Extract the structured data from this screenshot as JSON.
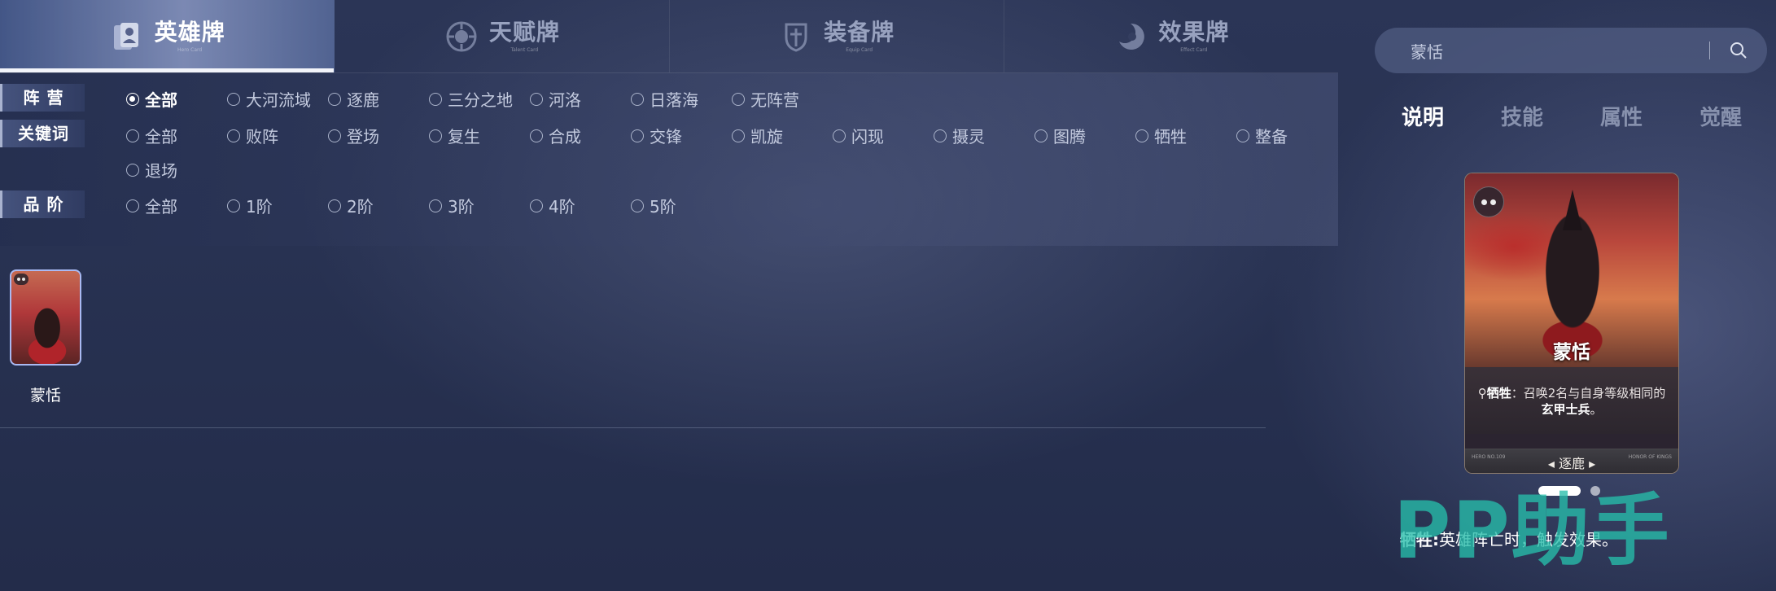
{
  "tabs": [
    {
      "label": "英雄牌",
      "sub": "Hero Card",
      "icon": "hero-card-icon",
      "active": true
    },
    {
      "label": "天赋牌",
      "sub": "Talent Card",
      "icon": "talent-card-icon",
      "active": false
    },
    {
      "label": "装备牌",
      "sub": "Equip Card",
      "icon": "equipment-card-icon",
      "active": false
    },
    {
      "label": "效果牌",
      "sub": "Effect Card",
      "icon": "effect-card-icon",
      "active": false
    }
  ],
  "filters": {
    "camp": {
      "label": "阵 营",
      "options": [
        "全部",
        "大河流域",
        "逐鹿",
        "三分之地",
        "河洛",
        "日落海",
        "无阵营"
      ],
      "selected": "全部"
    },
    "keyword": {
      "label": "关键词",
      "options": [
        "全部",
        "败阵",
        "登场",
        "复生",
        "合成",
        "交锋",
        "凯旋",
        "闪现",
        "摄灵",
        "图腾",
        "牺牲",
        "整备",
        "退场"
      ]
    },
    "grade": {
      "label": "品 阶",
      "options": [
        "全部",
        "1阶",
        "2阶",
        "3阶",
        "4阶",
        "5阶"
      ]
    }
  },
  "results": [
    {
      "name": "蒙恬"
    }
  ],
  "search": {
    "value": "蒙恬"
  },
  "detail_tabs": [
    "说明",
    "技能",
    "属性",
    "觉醒"
  ],
  "card": {
    "name": "蒙恬",
    "keyword": "牺牲",
    "desc_part1": "：召唤2名与自身等级相同的",
    "desc_bold": "玄甲士兵",
    "desc_end": "。",
    "camp": "逐鹿",
    "foot_left": "HERO NO.109",
    "foot_right": "HONOR OF KINGS",
    "accent": "#a9b9f2"
  },
  "skill": {
    "keyword": "牺牲:",
    "text": "英雄阵亡时，触发效果。"
  },
  "watermark": "PP助手"
}
